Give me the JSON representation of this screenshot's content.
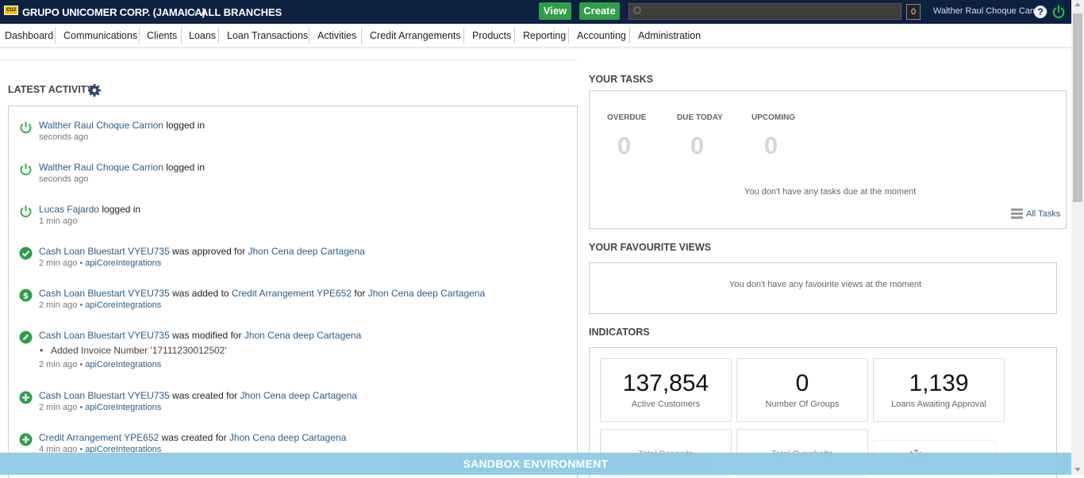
{
  "header": {
    "logo_text": "CUJ",
    "company": "GRUPO UNICOMER CORP. (JAMAICA)",
    "branch": "ALL BRANCHES",
    "view_label": "View",
    "create_label": "Create",
    "search_placeholder": "",
    "search_count": "0",
    "username": "Walther Raul Choque Carrion",
    "help_label": "?"
  },
  "nav": {
    "items": [
      "Dashboard",
      "Communications",
      "Clients",
      "Loans",
      "Loan Transactions",
      "Activities",
      "Credit Arrangements",
      "Products",
      "Reporting",
      "Accounting",
      "Administration"
    ]
  },
  "latest_activity": {
    "title": "LATEST ACTIVITY",
    "items": [
      {
        "icon": "power-icon",
        "link1": "Walther Raul Choque Carrion",
        "text1": " logged in",
        "time": "seconds ago"
      },
      {
        "icon": "power-icon",
        "link1": "Walther Raul Choque Carrion",
        "text1": " logged in",
        "time": "seconds ago"
      },
      {
        "icon": "power-icon",
        "link1": "Lucas Fajardo",
        "text1": " logged in",
        "time": "1 min ago"
      },
      {
        "icon": "check-icon",
        "link1": "Cash Loan Bluestart VYEU735",
        "text1": " was approved for ",
        "link2": "Jhon Cena deep Cartagena",
        "time": "2 min ago",
        "sep": " • ",
        "by": "apiCoreIntegrations"
      },
      {
        "icon": "dollar-icon",
        "link1": "Cash Loan Bluestart VYEU735",
        "text1": " was added to ",
        "link2": "Credit Arrangement YPE652",
        "text2": " for ",
        "link3": "Jhon Cena deep Cartagena",
        "time": "2 min ago",
        "sep": " • ",
        "by": "apiCoreIntegrations"
      },
      {
        "icon": "edit-icon",
        "link1": "Cash Loan Bluestart VYEU735",
        "text1": " was modified for ",
        "link2": "Jhon Cena deep Cartagena",
        "bullet": "Added Invoice Number '17111230012502'",
        "time": "2 min ago",
        "sep": " • ",
        "by": "apiCoreIntegrations"
      },
      {
        "icon": "plus-icon",
        "link1": "Cash Loan Bluestart VYEU735",
        "text1": " was created for ",
        "link2": "Jhon Cena deep Cartagena",
        "time": "2 min ago",
        "sep": " • ",
        "by": "apiCoreIntegrations"
      },
      {
        "icon": "plus-icon",
        "link1": "Credit Arrangement YPE652",
        "text1": " was created for ",
        "link2": "Jhon Cena deep Cartagena",
        "time": "4 min ago",
        "sep": " • ",
        "by": "apiCoreIntegrations"
      }
    ]
  },
  "tasks": {
    "title": "YOUR TASKS",
    "overdue_label": "OVERDUE",
    "overdue": "0",
    "due_today_label": "DUE TODAY",
    "due_today": "0",
    "upcoming_label": "UPCOMING",
    "upcoming": "0",
    "empty_note": "You don't have any tasks due at the moment",
    "all_tasks": "All Tasks"
  },
  "favourites": {
    "title": "YOUR FAVOURITE VIEWS",
    "empty_note": "You don't have any favourite views at the moment"
  },
  "indicators": {
    "title": "INDICATORS",
    "cards": [
      {
        "value": "137,854",
        "label": "Active Customers"
      },
      {
        "value": "0",
        "label": "Number Of Groups"
      },
      {
        "value": "1,139",
        "label": "Loans Awaiting Approval"
      }
    ],
    "partial": [
      "Total Deposits",
      "Total Overdrafts"
    ]
  },
  "sandbox": "SANDBOX ENVIRONMENT",
  "colors": {
    "topbar": "#0d2240",
    "green": "#2e9e4a",
    "link": "#2a5d87",
    "sandbox": "#8ecae6"
  }
}
